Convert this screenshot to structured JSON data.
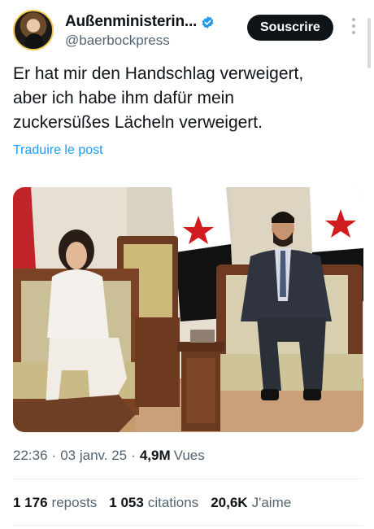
{
  "profile": {
    "display_name": "Außenministerin...",
    "handle": "@baerbockpress",
    "verified_color": "#1d9bf0"
  },
  "header": {
    "subscribe_label": "Souscrire",
    "more_icon": "vertical-ellipsis-icon"
  },
  "post": {
    "text": "Er hat mir den Handschlag verweigert,\naber ich habe ihm dafür mein\nzuckersüßes Lächeln verweigert.",
    "translate_label": "Traduire le post",
    "link_color": "#1d9bf0"
  },
  "meta": {
    "time": "22:36",
    "date": "03 janv. 25",
    "views_count": "4,9M",
    "views_label": "Vues"
  },
  "stats": {
    "reposts_count": "1 176",
    "reposts_label": "reposts",
    "quotes_count": "1 053",
    "quotes_label": "citations",
    "likes_count": "20,6K",
    "likes_label": "J'aime"
  }
}
